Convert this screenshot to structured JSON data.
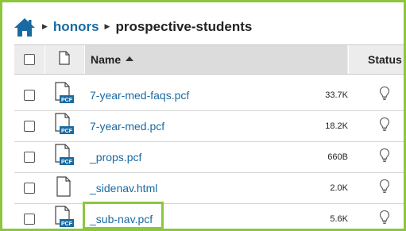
{
  "breadcrumb": {
    "home_icon": "home-icon",
    "link_label": "honors",
    "current_label": "prospective-students",
    "separator": "▶"
  },
  "table": {
    "columns": {
      "name": "Name",
      "status": "Status"
    },
    "rows": [
      {
        "name": "7-year-med-faqs.pcf",
        "size": "33.7K",
        "type": "pcf",
        "icon": "pcf-file-icon",
        "status_icon": "lightbulb-icon"
      },
      {
        "name": "7-year-med.pcf",
        "size": "18.2K",
        "type": "pcf",
        "icon": "pcf-file-icon",
        "status_icon": "lightbulb-icon"
      },
      {
        "name": "_props.pcf",
        "size": "660B",
        "type": "pcf",
        "icon": "pcf-file-icon",
        "status_icon": "lightbulb-icon"
      },
      {
        "name": "_sidenav.html",
        "size": "2.0K",
        "type": "html",
        "icon": "file-icon",
        "status_icon": "lightbulb-icon"
      },
      {
        "name": "_sub-nav.pcf",
        "size": "5.6K",
        "type": "pcf",
        "icon": "pcf-file-icon",
        "status_icon": "lightbulb-icon",
        "highlighted": true
      }
    ],
    "pcf_badge": "PCF"
  },
  "colors": {
    "accent_green": "#8cc63f",
    "link_blue": "#1a6aa1",
    "header_gray": "#ececec",
    "header_active_gray": "#dcdcdc",
    "pcf_badge_blue": "#1a6aa1"
  }
}
